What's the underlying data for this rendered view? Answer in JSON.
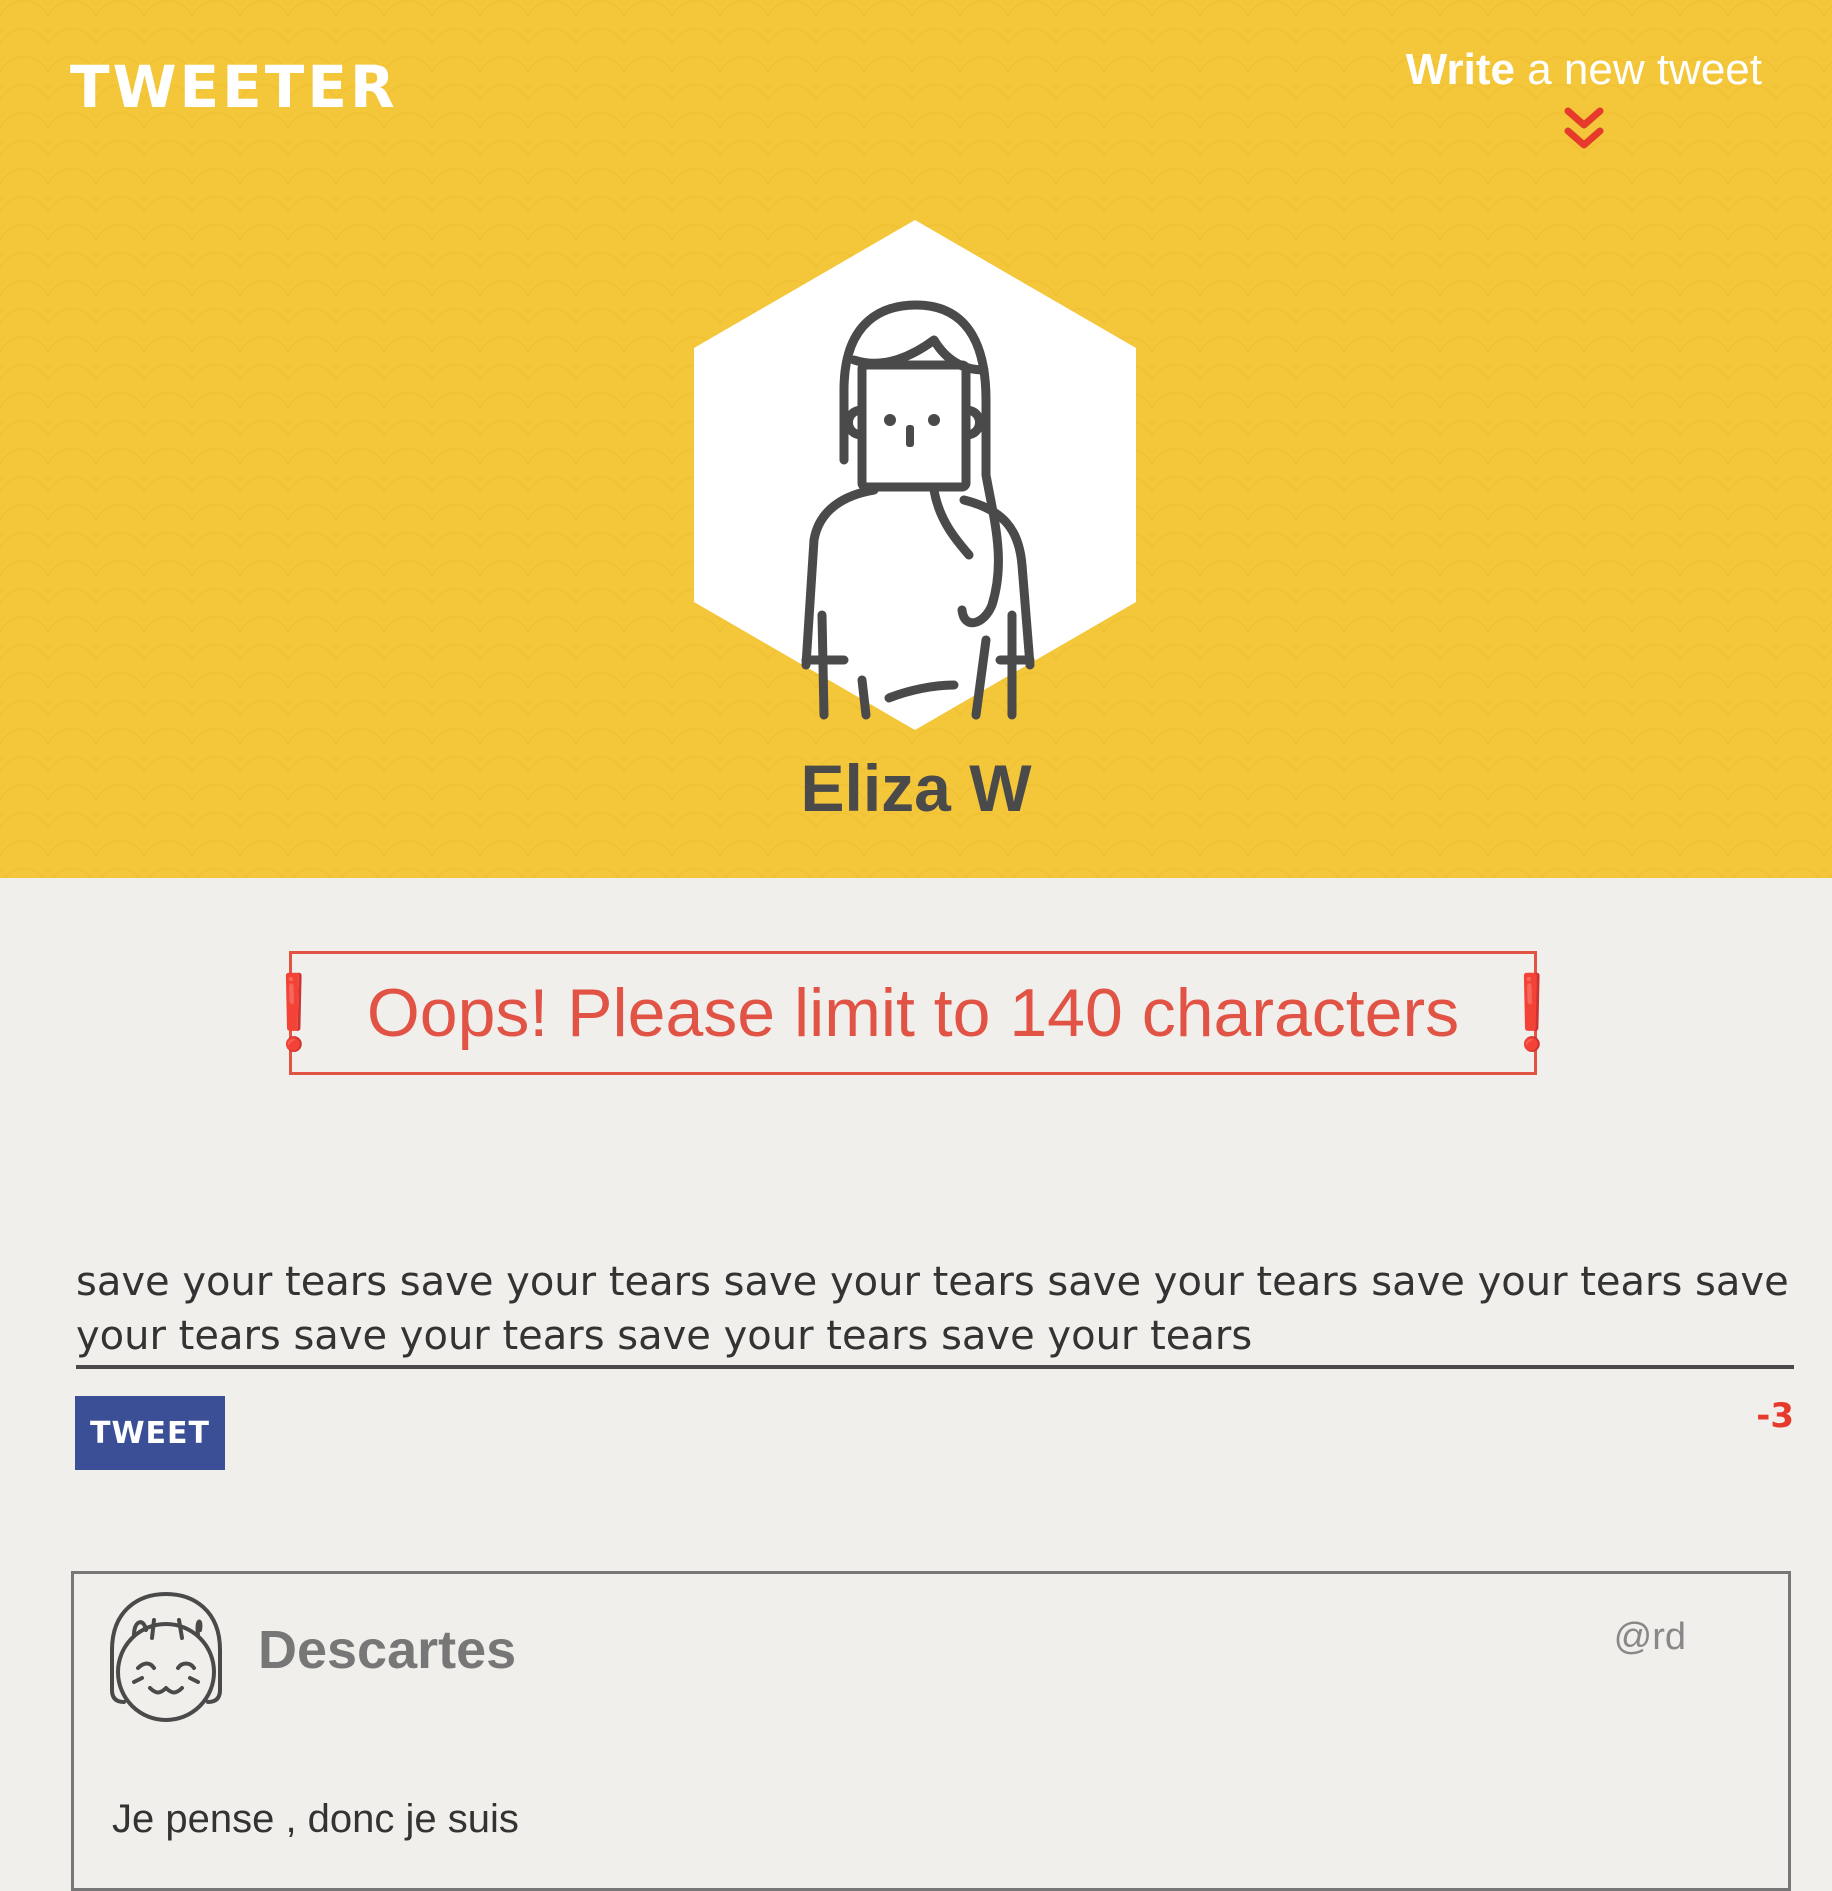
{
  "header": {
    "logo": "TWEETER",
    "compose_toggle": {
      "bold_label": "Write",
      "label": " a new tweet",
      "icon": "chevron-double-down-icon"
    },
    "profile": {
      "name": "Eliza W",
      "avatar_icon": "woman-avatar-icon"
    }
  },
  "error": {
    "message": "Oops! Please limit to 140 characters",
    "icon": "exclamation-icon"
  },
  "composer": {
    "text": "save your tears save your tears save your tears save your tears save your tears save your tears save your tears save your tears save your tears",
    "button_label": "TWEET",
    "counter": "-3"
  },
  "tweets": [
    {
      "author": "Descartes",
      "handle": "@rd",
      "body": "Je pense , donc je suis",
      "avatar_icon": "smiling-girl-avatar-icon"
    }
  ],
  "colors": {
    "header_bg": "#f4c63a",
    "page_bg": "#f1efeb",
    "error": "#e05345",
    "button": "#3a4f95",
    "counter": "#e53a2c"
  }
}
